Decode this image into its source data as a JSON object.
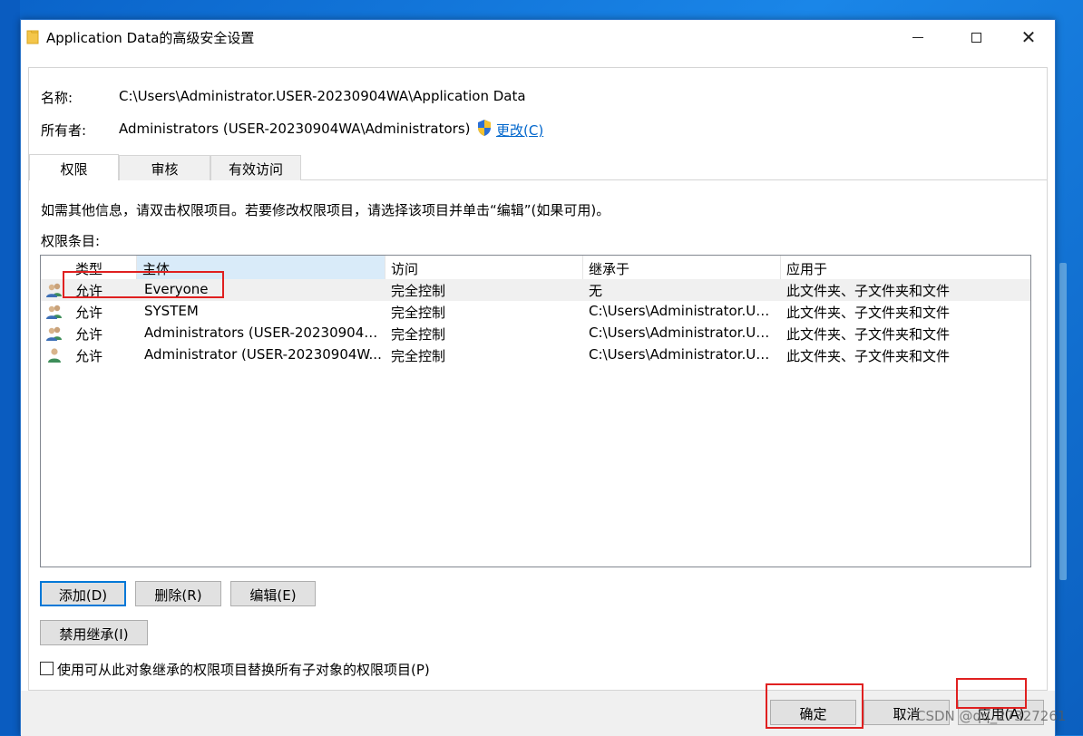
{
  "window": {
    "title": "Application Data的高级安全设置"
  },
  "fields": {
    "name_label": "名称:",
    "name_value": "C:\\Users\\Administrator.USER-20230904WA\\Application Data",
    "owner_label": "所有者:",
    "owner_value": "Administrators (USER-20230904WA\\Administrators)",
    "change_link": "更改(C)"
  },
  "tabs": [
    {
      "label": "权限",
      "active": true
    },
    {
      "label": "审核",
      "active": false
    },
    {
      "label": "有效访问",
      "active": false
    }
  ],
  "info_text": "如需其他信息，请双击权限项目。若要修改权限项目，请选择该项目并单击“编辑”(如果可用)。",
  "entries_label": "权限条目:",
  "table": {
    "columns": [
      "类型",
      "主体",
      "访问",
      "继承于",
      "应用于"
    ],
    "rows": [
      {
        "icon": "group-user-icon",
        "type": "允许",
        "principal": "Everyone",
        "access": "完全控制",
        "inherited": "无",
        "applies": "此文件夹、子文件夹和文件"
      },
      {
        "icon": "group-user-icon",
        "type": "允许",
        "principal": "SYSTEM",
        "access": "完全控制",
        "inherited": "C:\\Users\\Administrator.US...",
        "applies": "此文件夹、子文件夹和文件"
      },
      {
        "icon": "group-user-icon",
        "type": "允许",
        "principal": "Administrators (USER-20230904W...",
        "access": "完全控制",
        "inherited": "C:\\Users\\Administrator.US...",
        "applies": "此文件夹、子文件夹和文件"
      },
      {
        "icon": "single-user-icon",
        "type": "允许",
        "principal": "Administrator (USER-20230904W...",
        "access": "完全控制",
        "inherited": "C:\\Users\\Administrator.US...",
        "applies": "此文件夹、子文件夹和文件"
      }
    ]
  },
  "buttons": {
    "add": "添加(D)",
    "remove": "删除(R)",
    "edit": "编辑(E)",
    "disable_inheritance": "禁用继承(I)",
    "ok": "确定",
    "cancel": "取消",
    "apply": "应用(A)"
  },
  "checkbox": {
    "label": "使用可从此对象继承的权限项目替换所有子对象的权限项目(P)",
    "checked": false
  },
  "watermark": "CSDN @qq_27327261",
  "colors": {
    "annotation": "#e02020",
    "link": "#0066cc",
    "selection": "#d9ebf9"
  }
}
